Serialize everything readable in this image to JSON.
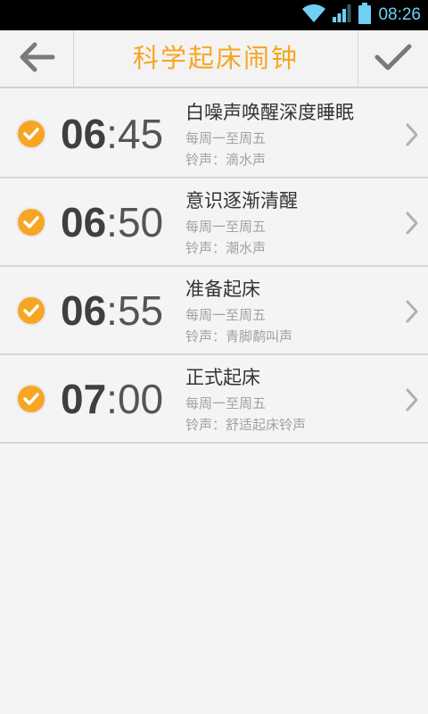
{
  "status_bar": {
    "time": "08:26",
    "icons": [
      "wifi-icon",
      "signal-icon",
      "battery-icon"
    ]
  },
  "header": {
    "title": "科学起床闹钟",
    "back_icon": "arrow-left-icon",
    "confirm_icon": "check-icon"
  },
  "alarms": [
    {
      "hour": "06",
      "minute": "45",
      "name": "白噪声唤醒深度睡眠",
      "repeat": "每周一至周五",
      "ringtone": "铃声：滴水声",
      "enabled": true
    },
    {
      "hour": "06",
      "minute": "50",
      "name": "意识逐渐清醒",
      "repeat": "每周一至周五",
      "ringtone": "铃声：潮水声",
      "enabled": true
    },
    {
      "hour": "06",
      "minute": "55",
      "name": "准备起床",
      "repeat": "每周一至周五",
      "ringtone": "铃声：青脚鹬叫声",
      "enabled": true
    },
    {
      "hour": "07",
      "minute": "00",
      "name": "正式起床",
      "repeat": "每周一至周五",
      "ringtone": "铃声：舒适起床铃声",
      "enabled": true
    }
  ],
  "colors": {
    "accent": "#f6a623",
    "status_clock": "#6fd0f5",
    "background": "#f4f4f4"
  }
}
